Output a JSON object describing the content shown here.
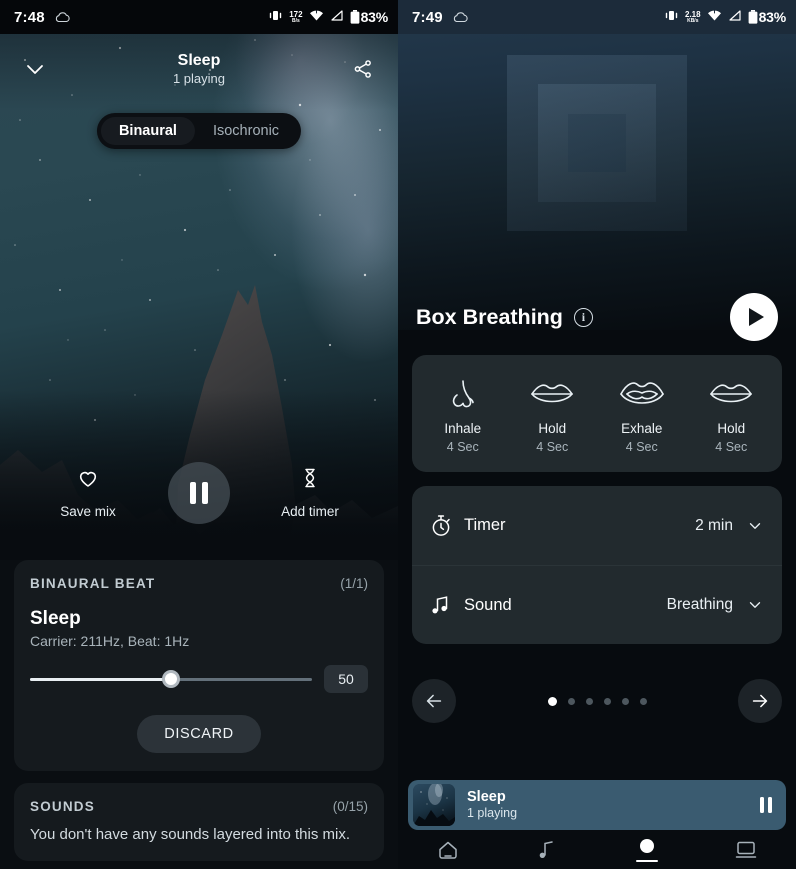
{
  "left": {
    "status": {
      "time": "7:48",
      "weather_icon": "cloud-icon",
      "vibrate_icon": "vibrate-icon",
      "net_rate": "172",
      "net_unit": "B/s",
      "wifi_icon": "wifi-icon",
      "signal_icon": "signal-icon",
      "battery_icon": "battery-icon",
      "battery": "83%"
    },
    "topbar": {
      "collapse_icon": "chevron-down-icon",
      "title": "Sleep",
      "subtitle": "1 playing",
      "share_icon": "share-icon"
    },
    "segmented": {
      "options": [
        "Binaural",
        "Isochronic"
      ],
      "selected": "Binaural"
    },
    "transport": {
      "save_icon": "heart-icon",
      "save_label": "Save mix",
      "play_state_icon": "pause-icon",
      "timer_icon": "hourglass-icon",
      "timer_label": "Add timer"
    },
    "binaural_card": {
      "header": "BINAURAL BEAT",
      "count": "(1/1)",
      "name": "Sleep",
      "meta": "Carrier: 211Hz, Beat: 1Hz",
      "volume_value": "50",
      "volume_percent": 50,
      "discard_label": "DISCARD"
    },
    "sounds_card": {
      "header": "SOUNDS",
      "count": "(0/15)",
      "empty_text": "You don't have any sounds layered into this mix."
    }
  },
  "right": {
    "status": {
      "time": "7:49",
      "weather_icon": "cloud-icon",
      "vibrate_icon": "vibrate-icon",
      "net_rate": "2.18",
      "net_unit": "KB/s",
      "wifi_icon": "wifi-icon",
      "signal_icon": "signal-icon",
      "battery_icon": "battery-icon",
      "battery": "83%"
    },
    "exercise": {
      "animation_icon": "nested-squares-icon",
      "title": "Box Breathing",
      "info_icon": "info-icon",
      "play_icon": "play-icon"
    },
    "phases": [
      {
        "icon": "nose-icon",
        "name": "Inhale",
        "duration": "4 Sec"
      },
      {
        "icon": "lips-closed-icon",
        "name": "Hold",
        "duration": "4 Sec"
      },
      {
        "icon": "lips-open-icon",
        "name": "Exhale",
        "duration": "4 Sec"
      },
      {
        "icon": "lips-closed-icon",
        "name": "Hold",
        "duration": "4 Sec"
      }
    ],
    "settings": [
      {
        "icon": "stopwatch-icon",
        "label": "Timer",
        "value": "2 min",
        "chevron": "chevron-down-icon"
      },
      {
        "icon": "music-note-icon",
        "label": "Sound",
        "value": "Breathing",
        "chevron": "chevron-down-icon"
      }
    ],
    "pager": {
      "prev_icon": "arrow-left-icon",
      "next_icon": "arrow-right-icon",
      "total_dots": 6,
      "active_index": 0
    },
    "miniplayer": {
      "artwork_icon": "album-art",
      "title": "Sleep",
      "subtitle": "1 playing",
      "pause_icon": "pause-icon"
    },
    "navbar": [
      {
        "icon": "home-icon",
        "active": false
      },
      {
        "icon": "music-icon",
        "active": false
      },
      {
        "icon": "breathe-icon",
        "active": true
      },
      {
        "icon": "library-icon",
        "active": false
      }
    ]
  },
  "colors": {
    "accent_mini": "#3a5b70",
    "card_left": "#151a1e",
    "card_right": "#222a2e"
  }
}
